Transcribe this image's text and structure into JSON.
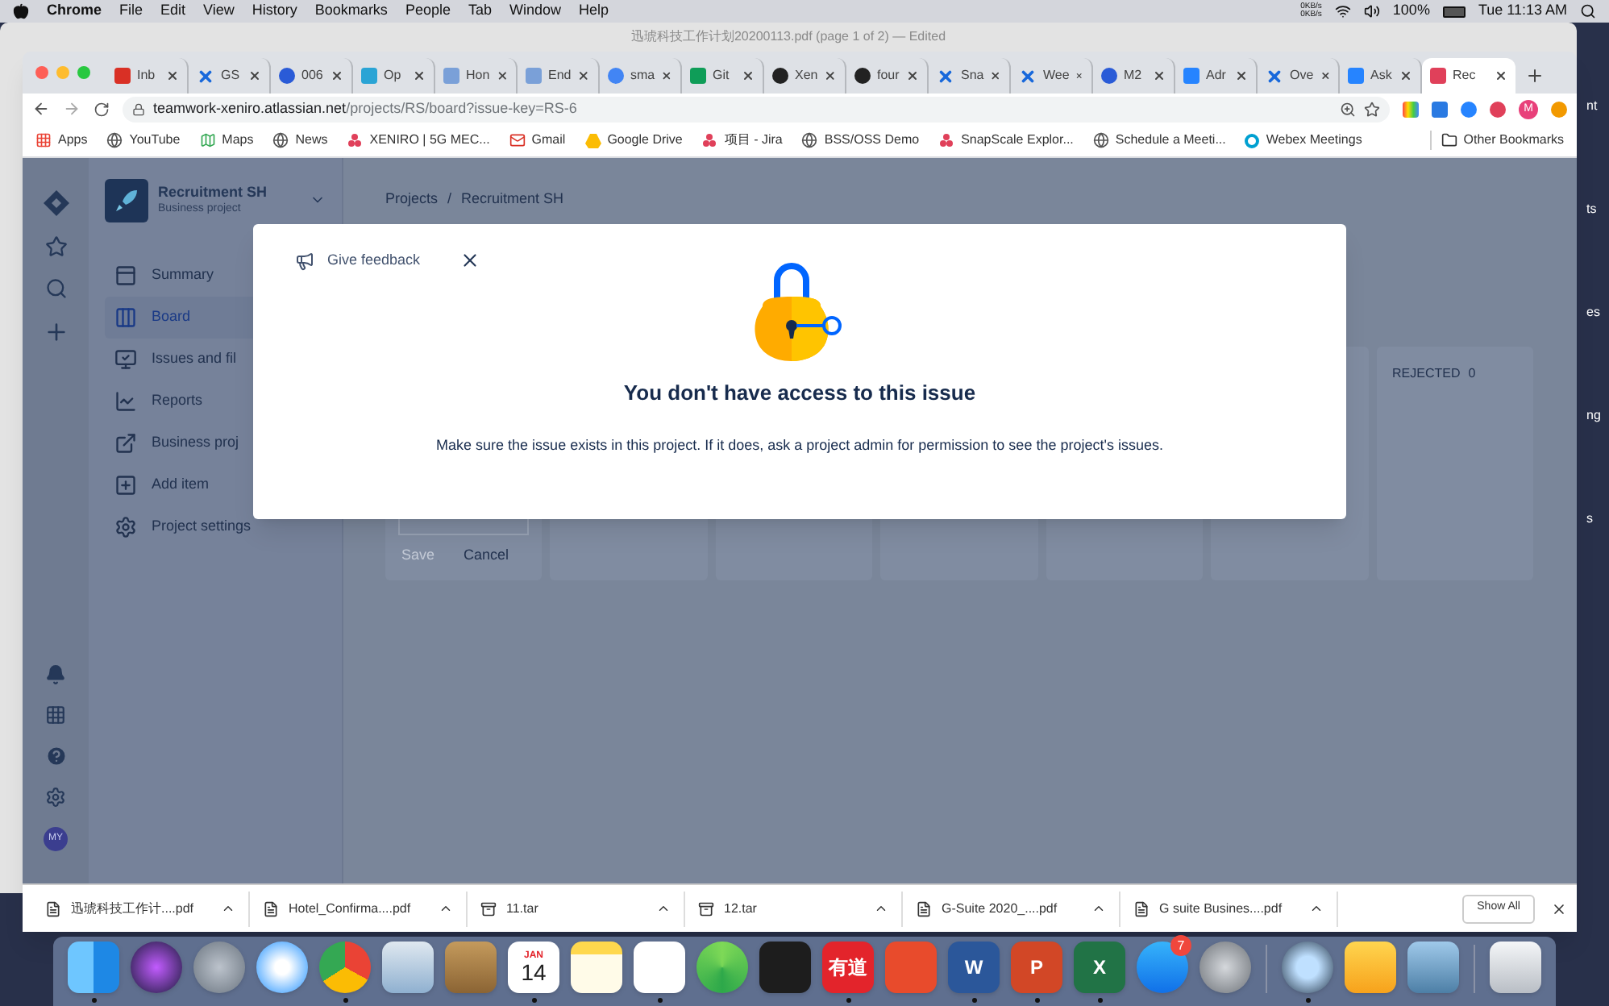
{
  "menu_bar": {
    "app": "Chrome",
    "items": [
      "File",
      "Edit",
      "View",
      "History",
      "Bookmarks",
      "People",
      "Tab",
      "Window",
      "Help"
    ],
    "network_up": "0KB/s",
    "network_down": "0KB/s",
    "battery": "100%",
    "clock": "Tue 11:13 AM"
  },
  "background_window": {
    "title": "迅琥科技工作计划20200113.pdf (page 1 of 2) — Edited"
  },
  "desktop_labels": [
    "nt",
    "ts",
    "es",
    "ng",
    "s"
  ],
  "browser": {
    "tabs": [
      {
        "label": "Inb",
        "selected": false
      },
      {
        "label": "GS",
        "selected": false
      },
      {
        "label": "006",
        "selected": false
      },
      {
        "label": "Op",
        "selected": false
      },
      {
        "label": "Hon",
        "selected": false
      },
      {
        "label": "End",
        "selected": false
      },
      {
        "label": "sma",
        "selected": false
      },
      {
        "label": "Git",
        "selected": false
      },
      {
        "label": "Xen",
        "selected": false
      },
      {
        "label": "four",
        "selected": false
      },
      {
        "label": "Sna",
        "selected": false
      },
      {
        "label": "Wee",
        "selected": false
      },
      {
        "label": "M2",
        "selected": false
      },
      {
        "label": "Adr",
        "selected": false
      },
      {
        "label": "Ove",
        "selected": false
      },
      {
        "label": "Ask",
        "selected": false
      },
      {
        "label": "Rec",
        "selected": true
      }
    ],
    "url_host": "teamwork-xeniro.atlassian.net",
    "url_path": "/projects/RS/board?issue-key=RS-6",
    "profile_initial": "M",
    "bookmarks": [
      "Apps",
      "YouTube",
      "Maps",
      "News",
      "XENIRO | 5G MEC...",
      "Gmail",
      "Google Drive",
      "项目 - Jira",
      "BSS/OSS Demo",
      "SnapScale Explor...",
      "Schedule a Meeti...",
      "Webex Meetings"
    ],
    "other_bookmarks": "Other Bookmarks"
  },
  "jira": {
    "avatar_initials": "MY",
    "project": {
      "name": "Recruitment SH",
      "type": "Business project"
    },
    "nav": [
      {
        "label": "Summary",
        "selected": false
      },
      {
        "label": "Board",
        "selected": true
      },
      {
        "label": "Issues and fil",
        "selected": false
      },
      {
        "label": "Reports",
        "selected": false
      },
      {
        "label": "Business proj",
        "selected": false
      },
      {
        "label": "Add item",
        "selected": false
      },
      {
        "label": "Project settings",
        "selected": false
      }
    ],
    "breadcrumbs": [
      "Projects",
      "Recruitment SH"
    ],
    "breadcrumb_separator": "/",
    "columns": [
      {
        "kind": "form",
        "save": "Save",
        "cancel": "Cancel"
      },
      {
        "kind": "empty"
      },
      {
        "kind": "empty"
      },
      {
        "kind": "empty"
      },
      {
        "kind": "empty"
      },
      {
        "kind": "empty"
      },
      {
        "kind": "titled",
        "title": "REJECTED",
        "count": "0"
      }
    ],
    "modal": {
      "feedback": "Give feedback",
      "title": "You don't have access to this issue",
      "message": "Make sure the issue exists in this project. If it does, ask a project admin for permission to see the project's issues."
    }
  },
  "downloads": {
    "items": [
      {
        "name": "迅琥科技工作计....pdf",
        "kind": "pdf"
      },
      {
        "name": "Hotel_Confirma....pdf",
        "kind": "pdf"
      },
      {
        "name": "11.tar",
        "kind": "archive"
      },
      {
        "name": "12.tar",
        "kind": "archive"
      },
      {
        "name": "G-Suite 2020_....pdf",
        "kind": "pdf"
      },
      {
        "name": "G suite Busines....pdf",
        "kind": "pdf"
      }
    ],
    "show_all": "Show All"
  },
  "dock": [
    {
      "running": true
    },
    {
      "running": false
    },
    {
      "running": false
    },
    {
      "running": false
    },
    {
      "running": true
    },
    {
      "running": false
    },
    {
      "running": false
    },
    {
      "running": true,
      "month": "JAN",
      "day": "14"
    },
    {
      "running": false
    },
    {
      "running": true
    },
    {
      "running": false
    },
    {
      "running": false
    },
    {
      "running": true,
      "label": "有道"
    },
    {
      "running": false
    },
    {
      "running": true,
      "label": "W"
    },
    {
      "running": true,
      "label": "P"
    },
    {
      "running": true,
      "label": "X"
    },
    {
      "running": false,
      "badge": "7"
    },
    {
      "running": false
    },
    {
      "running": true
    },
    {
      "running": false
    },
    {
      "running": false
    },
    {
      "running": false
    }
  ]
}
